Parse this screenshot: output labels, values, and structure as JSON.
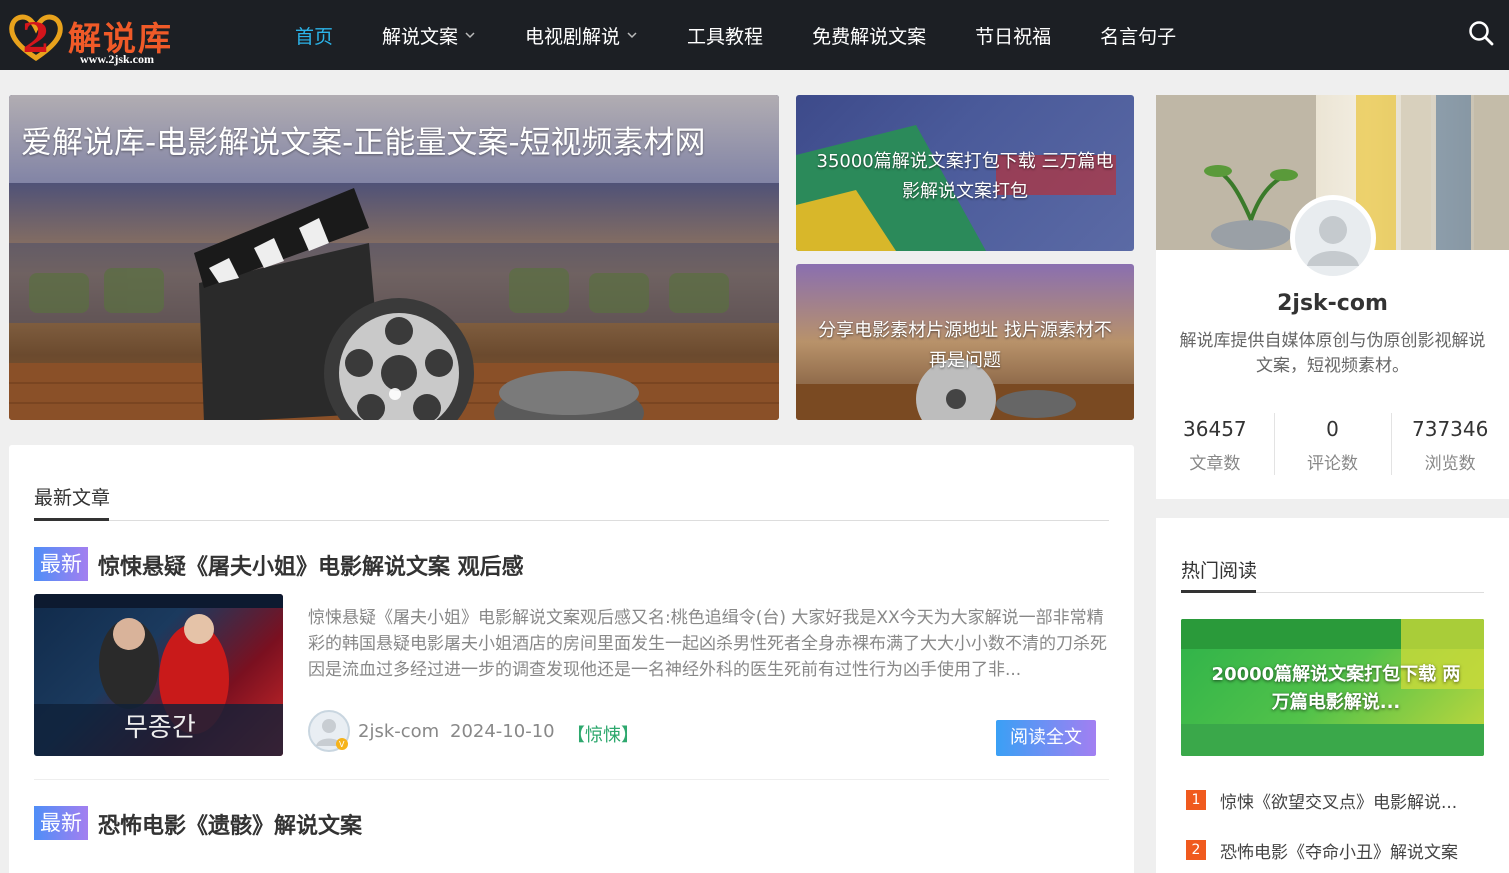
{
  "header": {
    "logo_text": "解说库",
    "logo_url": "www.2jsk.com",
    "nav": [
      {
        "label": "首页",
        "active": true,
        "dropdown": false
      },
      {
        "label": "解说文案",
        "active": false,
        "dropdown": true
      },
      {
        "label": "电视剧解说",
        "active": false,
        "dropdown": true
      },
      {
        "label": "工具教程",
        "active": false,
        "dropdown": false
      },
      {
        "label": "免费解说文案",
        "active": false,
        "dropdown": false
      },
      {
        "label": "节日祝福",
        "active": false,
        "dropdown": false
      },
      {
        "label": "名言句子",
        "active": false,
        "dropdown": false
      }
    ],
    "search_icon": "search-icon"
  },
  "banner": {
    "title": "爱解说库-电影解说文案-正能量文案-短视频素材网"
  },
  "side_cards": [
    {
      "caption": "35000篇解说文案打包下载 三万篇电影解说文案打包"
    },
    {
      "caption": "分享电影素材片源地址 找片源素材不再是问题"
    }
  ],
  "main": {
    "section_title": "最新文章",
    "posts": [
      {
        "tag": "最新",
        "title": "惊悚悬疑《屠夫小姐》电影解说文案 观后感",
        "excerpt": "惊悚悬疑《屠夫小姐》电影解说文案观后感又名:桃色追缉令(台) 大家好我是XX今天为大家解说一部非常精彩的韩国悬疑电影屠夫小姐酒店的房间里面发生一起凶杀男性死者全身赤裸布满了大大小小数不清的刀杀死因是流血过多经过进一步的调查发现他还是一名神经外科的医生死前有过性行为凶手使用了非...",
        "author": "2jsk-com",
        "date": "2024-10-10",
        "category": "【惊悚】",
        "read_label": "阅读全文"
      },
      {
        "tag": "最新",
        "title": "恐怖电影《遗骸》解说文案"
      }
    ]
  },
  "profile": {
    "name": "2jsk-com",
    "description": "解说库提供自媒体原创与伪原创影视解说文案，短视频素材。",
    "stats": [
      {
        "num": "36457",
        "label": "文章数"
      },
      {
        "num": "0",
        "label": "评论数"
      },
      {
        "num": "737346",
        "label": "浏览数"
      }
    ]
  },
  "hot": {
    "title": "热门阅读",
    "banner_text": "20000篇解说文案打包下载 两万篇电影解说...",
    "items": [
      {
        "num": "1",
        "text": "惊悚《欲望交叉点》电影解说..."
      },
      {
        "num": "2",
        "text": "恐怖电影《夺命小丑》解说文案"
      }
    ]
  },
  "colors": {
    "header_bg": "#1c1f24",
    "nav_active": "#2bb3e8",
    "logo": "#f05a28",
    "category": "#2ea86e",
    "hot_badge": "#f05a1e"
  }
}
